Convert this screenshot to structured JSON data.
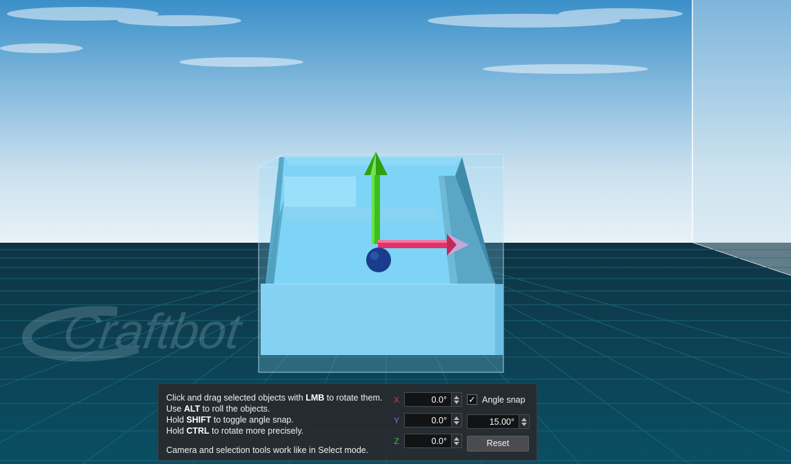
{
  "rotate_panel": {
    "instructions": {
      "line1": {
        "pre": "Click and drag selected objects with ",
        "key": "LMB",
        "post": " to rotate them."
      },
      "line2": {
        "pre": "Use ",
        "key": "ALT",
        "post": " to roll the objects."
      },
      "line3": {
        "pre": "Hold ",
        "key": "SHIFT",
        "post": " to toggle angle snap."
      },
      "line4": {
        "pre": "Hold ",
        "key": "CTRL",
        "post": " to rotate more precisely."
      },
      "line5": "Camera and selection tools work like in Select mode."
    },
    "axes": {
      "x": {
        "label": "X",
        "value": "0.0°",
        "color": "#d83a3a"
      },
      "y": {
        "label": "Y",
        "value": "0.0°",
        "color": "#7c6cd8"
      },
      "z": {
        "label": "Z",
        "value": "0.0°",
        "color": "#3cc03c"
      }
    },
    "angle_snap": {
      "label": "Angle snap",
      "checked": true,
      "check_glyph": "✓",
      "value": "15.00°"
    },
    "reset_label": "Reset"
  },
  "scene": {
    "watermark_text": "Craftbot",
    "gizmo_colors": {
      "up_axis": "#3cbf1e",
      "side_axis": "#e0336b",
      "pivot": "#1a3c8c"
    },
    "object_color": "#7fd0f5"
  }
}
